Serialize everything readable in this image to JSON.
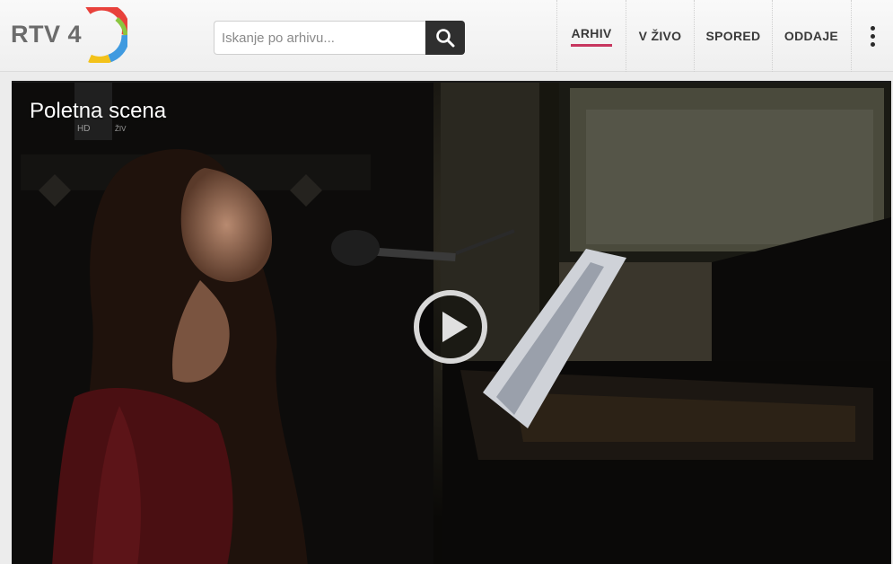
{
  "brand": {
    "logo_text": "RTV 4"
  },
  "search": {
    "placeholder": "Iskanje po arhivu...",
    "value": ""
  },
  "nav": {
    "items": [
      {
        "label": "ARHIV",
        "active": true
      },
      {
        "label": "V ŽIVO",
        "active": false
      },
      {
        "label": "SPORED",
        "active": false
      },
      {
        "label": "ODDAJE",
        "active": false
      }
    ],
    "menu_icon": "vertical-dots-icon"
  },
  "player": {
    "title": "Poletna scena",
    "play_icon": "play-icon",
    "overlay_marks": [
      "HD",
      "ŽIV"
    ]
  },
  "colors": {
    "accent": "#c7375f",
    "search_button": "#2f2f2f",
    "header_bg": "#f4f4f4"
  }
}
